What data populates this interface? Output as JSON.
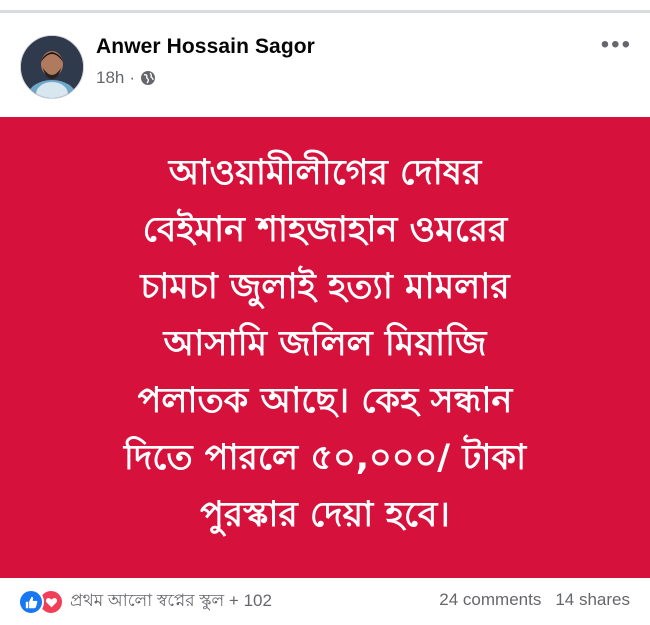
{
  "post": {
    "author": "Anwer Hossain Sagor",
    "time": "18h",
    "separator": "·",
    "privacy_icon": "globe-icon",
    "more_icon": "more-options-icon",
    "more_label": "•••"
  },
  "banner": {
    "background": "#d6123c",
    "lines": [
      "আওয়ামীলীগের দোষর",
      "বেইমান শাহজাহান ওমরের",
      "চামচা জুলাই হত্যা মামলার",
      "আসামি জলিল মিয়াজি",
      "পলাতক আছে। কেহ সন্ধান",
      "দিতে পারলে ৫০,০০০/ টাকা",
      "পুরস্কার দেয়া হবে।"
    ]
  },
  "footer": {
    "reaction_icons": [
      "like-icon",
      "love-icon"
    ],
    "reaction_names": "প্রথম আলো স্বপ্নের স্কুল + 102",
    "comments": "24 comments",
    "shares": "14 shares"
  },
  "colors": {
    "like": "#1877f2",
    "love": "#f33e58",
    "secondary_text": "#65676b"
  }
}
